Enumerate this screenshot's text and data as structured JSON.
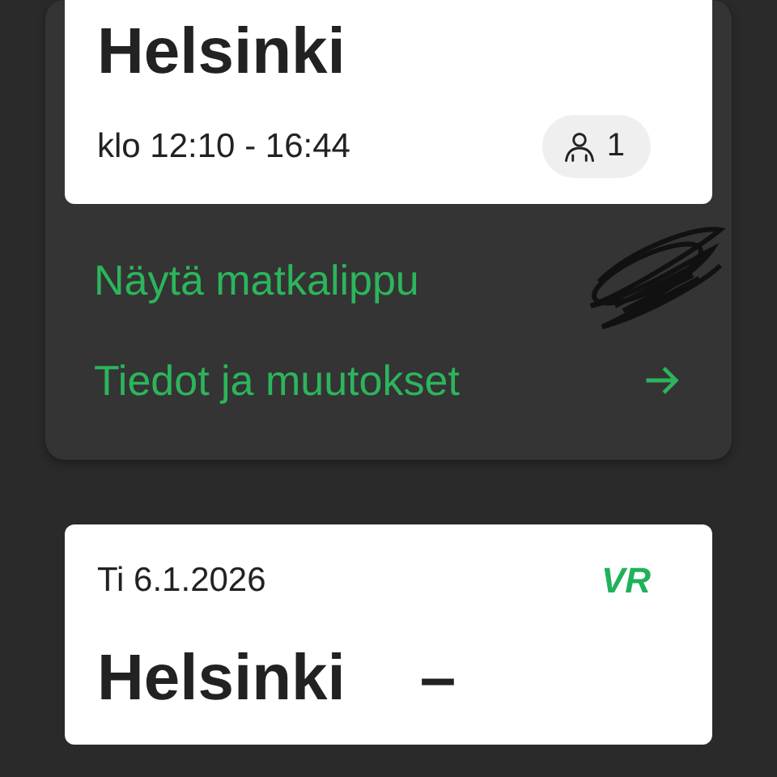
{
  "trips": [
    {
      "title_lines": [
        [
          "Helsinki"
        ]
      ],
      "time": "klo 12:10 - 16:44",
      "passengers": "1",
      "links": [
        {
          "label": "Näytä matkalippu",
          "redacted": true
        },
        {
          "label": "Tiedot ja muutokset",
          "redacted": false
        }
      ]
    },
    {
      "date": "Ti 6.1.2026",
      "logo": "VR",
      "title_lines": [
        [
          "Helsinki",
          "–"
        ]
      ]
    }
  ]
}
